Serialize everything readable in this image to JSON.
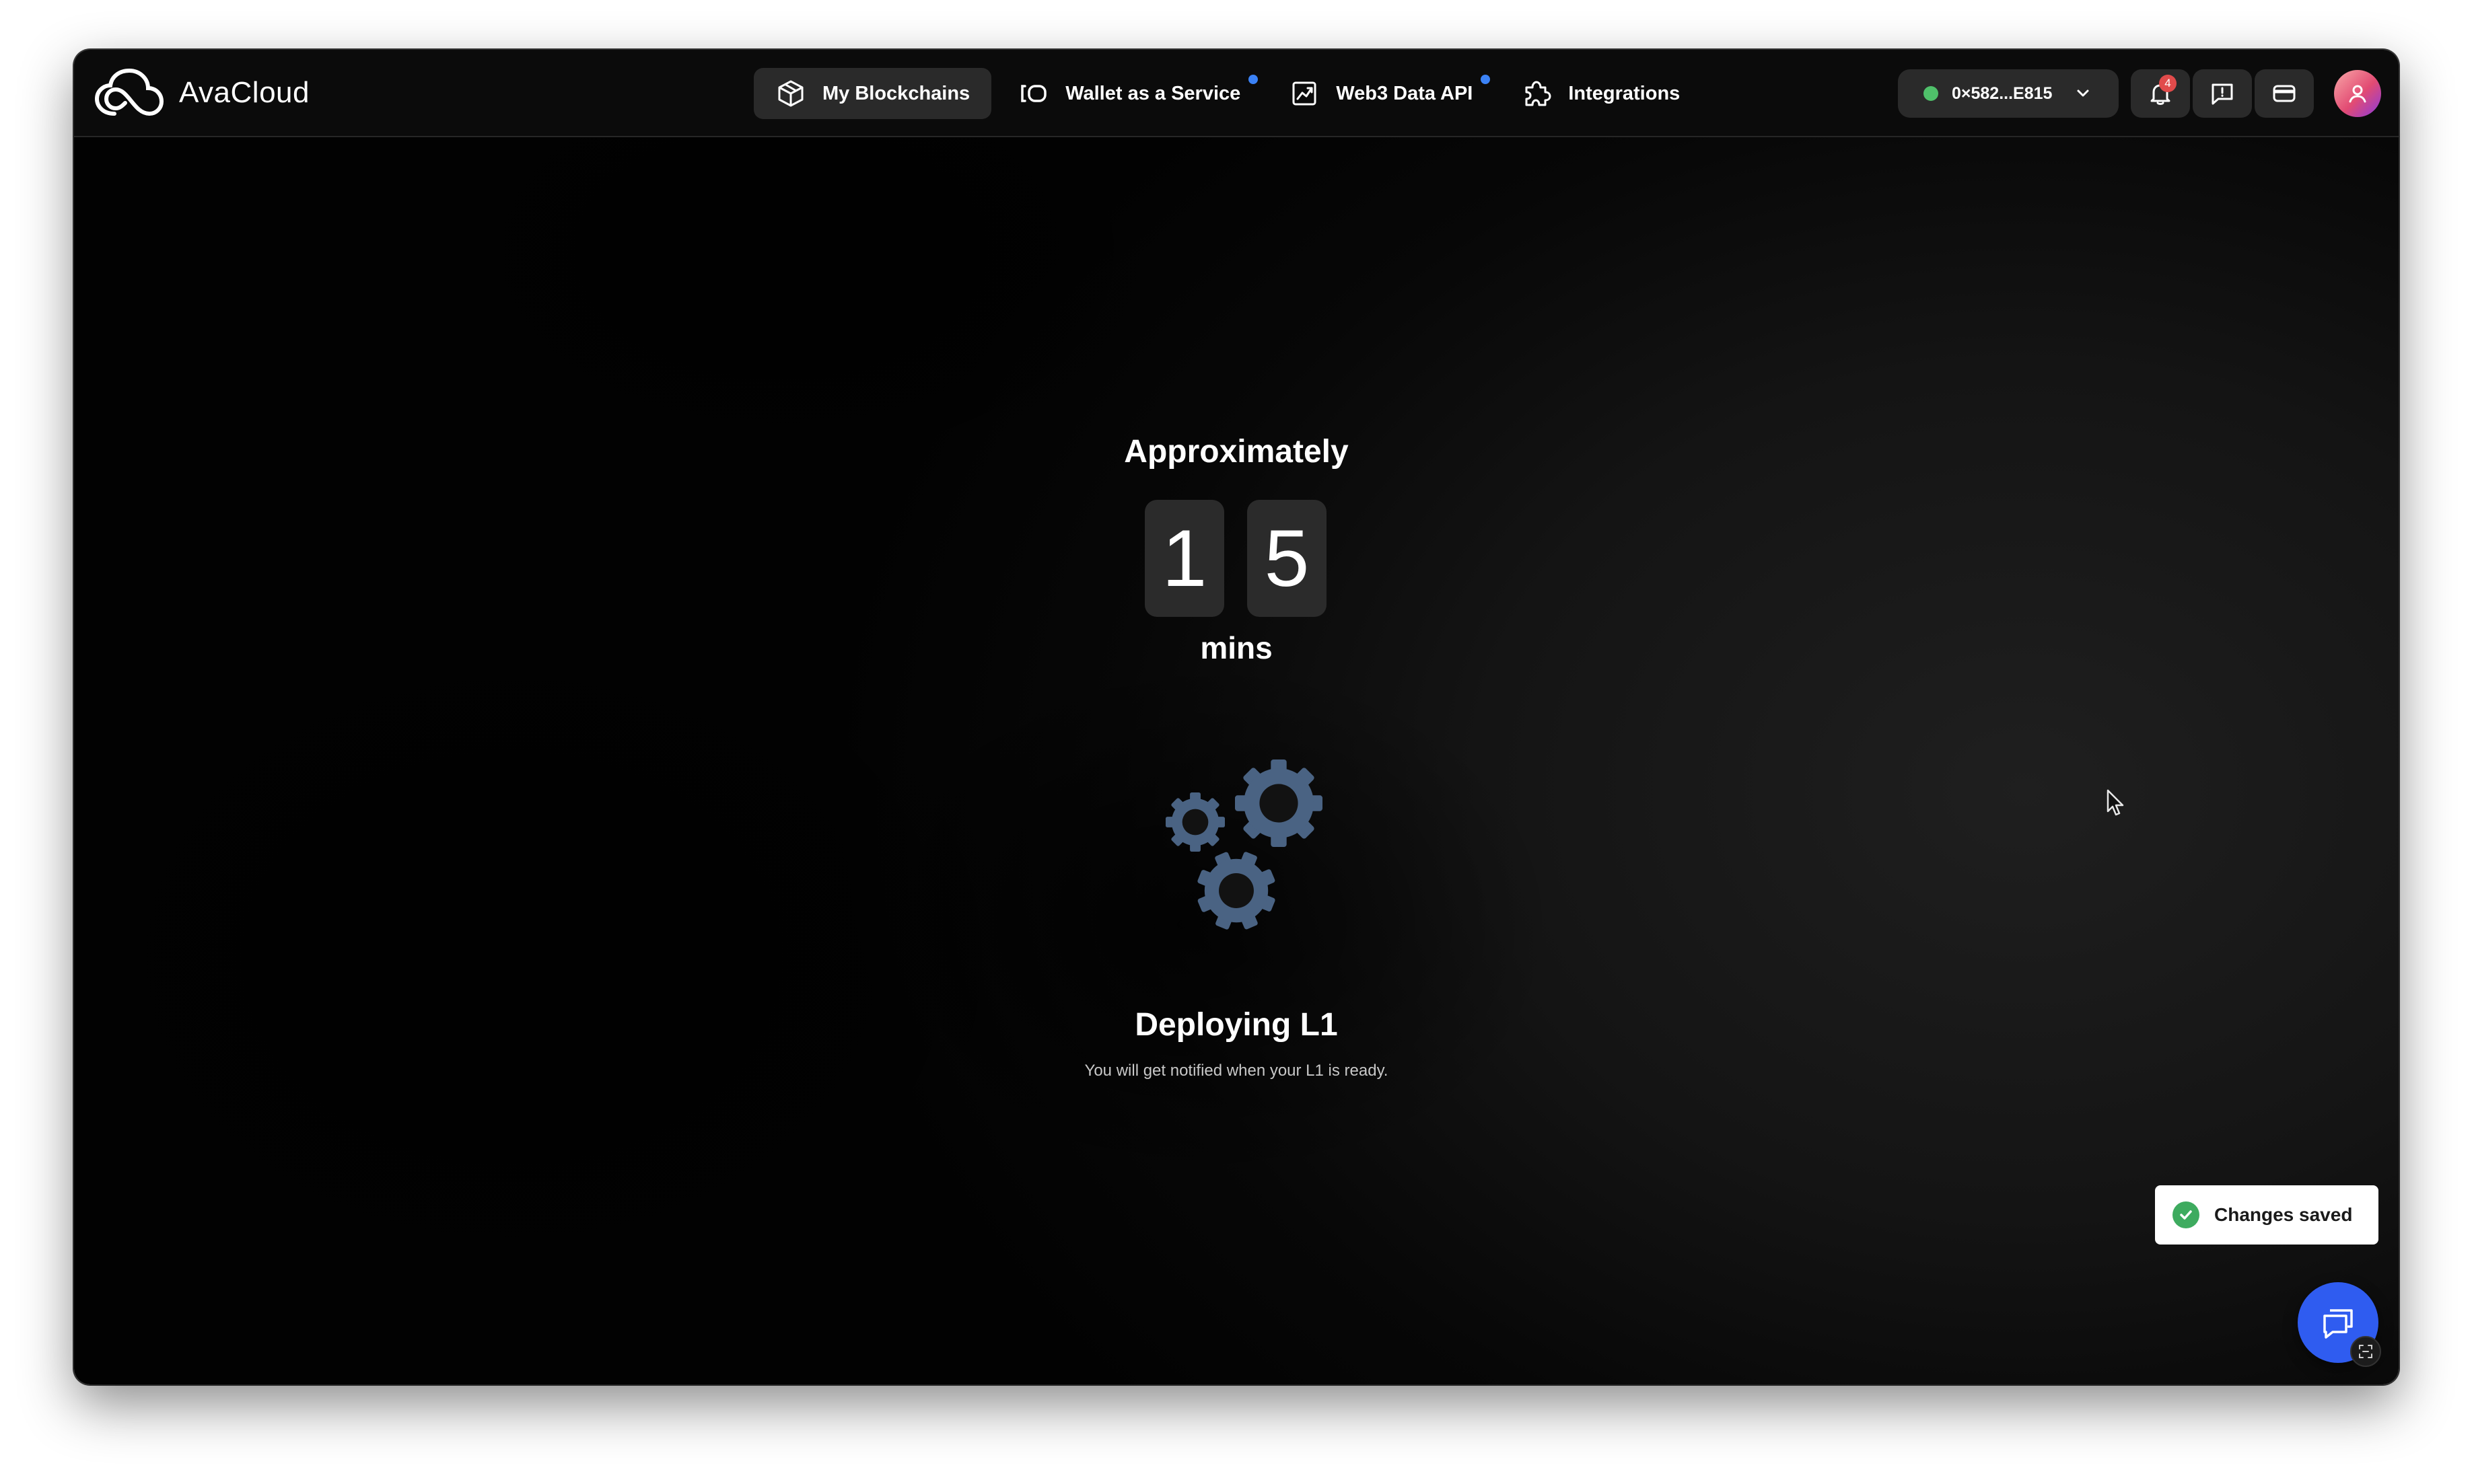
{
  "app": {
    "name": "AvaCloud"
  },
  "nav": {
    "items": [
      {
        "label": "My Blockchains",
        "icon": "cube-icon",
        "active": true,
        "dot": false
      },
      {
        "label": "Wallet as a Service",
        "icon": "wallet-icon",
        "active": false,
        "dot": true
      },
      {
        "label": "Web3 Data API",
        "icon": "chart-icon",
        "active": false,
        "dot": true
      },
      {
        "label": "Integrations",
        "icon": "puzzle-icon",
        "active": false,
        "dot": false
      }
    ]
  },
  "account": {
    "wallet_address": "0×582...E815",
    "status_color": "#4fc06a",
    "notification_count": "4"
  },
  "deployment": {
    "approx_label": "Approximately",
    "digits": [
      "1",
      "5"
    ],
    "unit": "mins",
    "title": "Deploying L1",
    "subtitle": "You will get notified when your L1 is ready."
  },
  "toast": {
    "message": "Changes saved",
    "status_color": "#3eab5f"
  },
  "colors": {
    "accent": "#2f5cf0",
    "gear": "#4a6383",
    "nav_dot": "#3b82f6",
    "badge": "#e14b4b"
  }
}
